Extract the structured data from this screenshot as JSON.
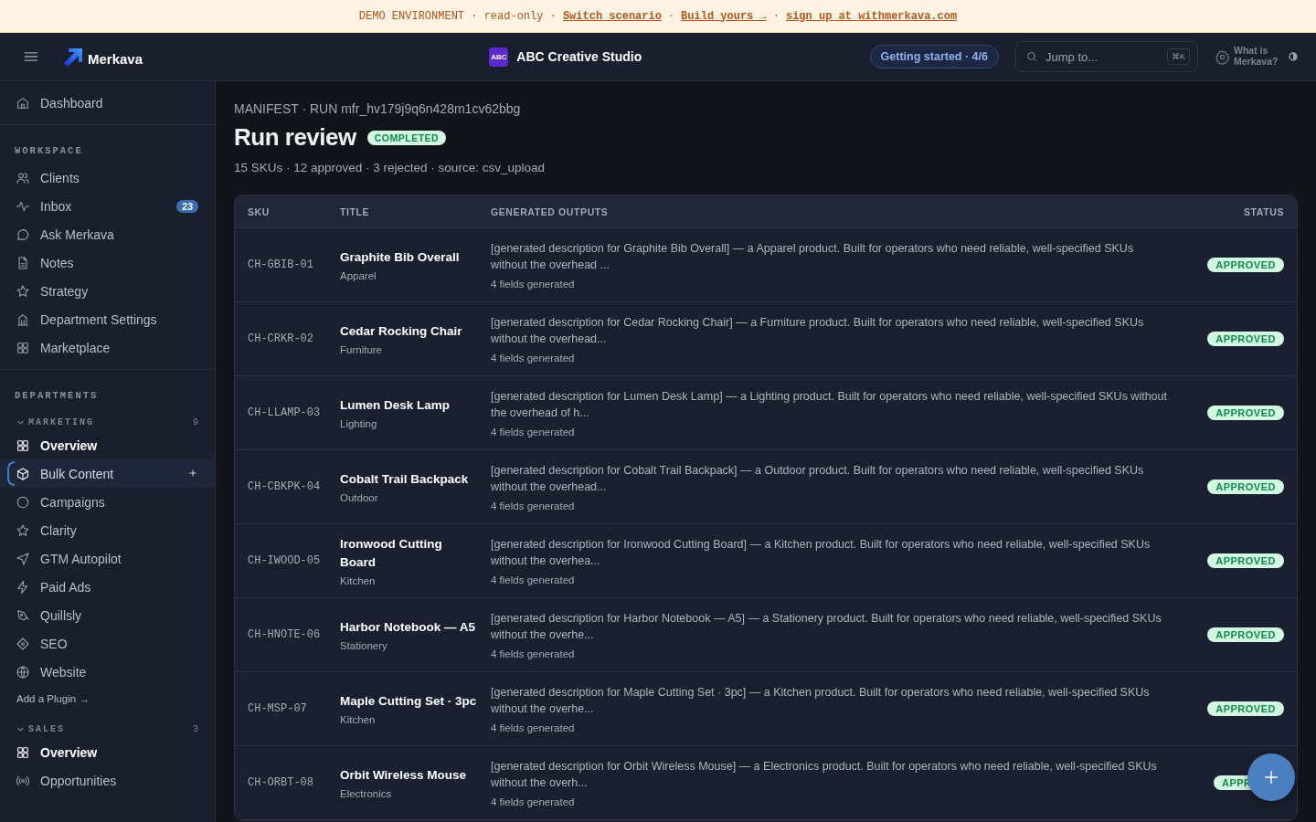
{
  "banner": {
    "parts": [
      {
        "kind": "text",
        "text": "DEMO ENVIRONMENT · read-only ·"
      },
      {
        "kind": "link",
        "text": "Switch scenario"
      },
      {
        "kind": "text",
        "text": "·"
      },
      {
        "kind": "link",
        "text": "Build yours →"
      },
      {
        "kind": "text",
        "text": "·"
      },
      {
        "kind": "link",
        "text": "sign up at withmerkava.com"
      }
    ]
  },
  "header": {
    "brand": "Merkava",
    "workspace_logo": "ABC",
    "workspace": "ABC Creative Studio",
    "getting_started": "Getting started · 4/6",
    "search": {
      "placeholder": "Jump to...",
      "shortcut": "⌘K"
    },
    "help": "What is Merkava?"
  },
  "sidebar": {
    "top": [
      {
        "label": "Dashboard",
        "selected": false
      }
    ],
    "workspace": {
      "heading": "WORKSPACE",
      "items": [
        {
          "label": "Clients",
          "selected": false
        },
        {
          "label": "Inbox",
          "selected": false,
          "badge": "23"
        },
        {
          "label": "Ask Merkava",
          "selected": false
        },
        {
          "label": "Notes",
          "selected": false
        },
        {
          "label": "Strategy",
          "selected": false
        },
        {
          "label": "Department Settings",
          "selected": false
        },
        {
          "label": "Marketplace",
          "selected": false
        }
      ]
    },
    "departments_heading": "DEPARTMENTS",
    "departments": [
      {
        "name": "MARKETING",
        "count": "9",
        "expanded": true,
        "items": [
          {
            "label": "Overview",
            "selected": false,
            "bold": true
          },
          {
            "label": "Bulk Content",
            "selected": true,
            "bold": false,
            "addable": true
          },
          {
            "label": "Campaigns",
            "selected": false,
            "bold": false
          },
          {
            "label": "Clarity",
            "selected": false,
            "bold": false
          },
          {
            "label": "GTM Autopilot",
            "selected": false,
            "bold": false
          },
          {
            "label": "Paid Ads",
            "selected": false,
            "bold": false
          },
          {
            "label": "Quillsly",
            "selected": false,
            "bold": false
          },
          {
            "label": "SEO",
            "selected": false,
            "bold": false
          },
          {
            "label": "Website",
            "selected": false,
            "bold": false
          }
        ],
        "add_link": "Add a Plugin →"
      },
      {
        "name": "SALES",
        "count": "3",
        "expanded": true,
        "items": [
          {
            "label": "Overview",
            "selected": false,
            "bold": true
          },
          {
            "label": "Opportunities",
            "selected": false,
            "bold": false
          }
        ]
      }
    ]
  },
  "page": {
    "breadcrumb": "MANIFEST · RUN mfr_hv179j9q6n428m1cv62bbg",
    "title": "Run review",
    "status": "COMPLETED",
    "summary": "15 SKUs · 12 approved · 3 rejected · source: csv_upload"
  },
  "table": {
    "columns": [
      "SKU",
      "TITLE",
      "GENERATED OUTPUTS",
      "STATUS"
    ],
    "rows": [
      {
        "sku": "CH-GBIB-01",
        "title": "Graphite Bib Overall",
        "category": "Apparel",
        "output": "[generated description for Graphite Bib Overall] — a Apparel product. Built for operators who need reliable, well-specified SKUs without the overhead ...",
        "fields": "4 fields generated",
        "status": "APPROVED"
      },
      {
        "sku": "CH-CRKR-02",
        "title": "Cedar Rocking Chair",
        "category": "Furniture",
        "output": "[generated description for Cedar Rocking Chair] — a Furniture product. Built for operators who need reliable, well-specified SKUs without the overhead...",
        "fields": "4 fields generated",
        "status": "APPROVED"
      },
      {
        "sku": "CH-LLAMP-03",
        "title": "Lumen Desk Lamp",
        "category": "Lighting",
        "output": "[generated description for Lumen Desk Lamp] — a Lighting product. Built for operators who need reliable, well-specified SKUs without the overhead of h...",
        "fields": "4 fields generated",
        "status": "APPROVED"
      },
      {
        "sku": "CH-CBKPK-04",
        "title": "Cobalt Trail Backpack",
        "category": "Outdoor",
        "output": "[generated description for Cobalt Trail Backpack] — a Outdoor product. Built for operators who need reliable, well-specified SKUs without the overhead...",
        "fields": "4 fields generated",
        "status": "APPROVED"
      },
      {
        "sku": "CH-IWOOD-05",
        "title": "Ironwood Cutting Board",
        "category": "Kitchen",
        "output": "[generated description for Ironwood Cutting Board] — a Kitchen product. Built for operators who need reliable, well-specified SKUs without the overhea...",
        "fields": "4 fields generated",
        "status": "APPROVED"
      },
      {
        "sku": "CH-HNOTE-06",
        "title": "Harbor Notebook — A5",
        "category": "Stationery",
        "output": "[generated description for Harbor Notebook — A5] — a Stationery product. Built for operators who need reliable, well-specified SKUs without the overhe...",
        "fields": "4 fields generated",
        "status": "APPROVED"
      },
      {
        "sku": "CH-MSP-07",
        "title": "Maple Cutting Set · 3pc",
        "category": "Kitchen",
        "output": "[generated description for Maple Cutting Set · 3pc] — a Kitchen product. Built for operators who need reliable, well-specified SKUs without the overhe...",
        "fields": "4 fields generated",
        "status": "APPROVED"
      },
      {
        "sku": "CH-ORBT-08",
        "title": "Orbit Wireless Mouse",
        "category": "Electronics",
        "output": "[generated description for Orbit Wireless Mouse] — a Electronics product. Built for operators who need reliable, well-specified SKUs without the overh...",
        "fields": "4 fields generated",
        "status": "APPR"
      }
    ]
  }
}
